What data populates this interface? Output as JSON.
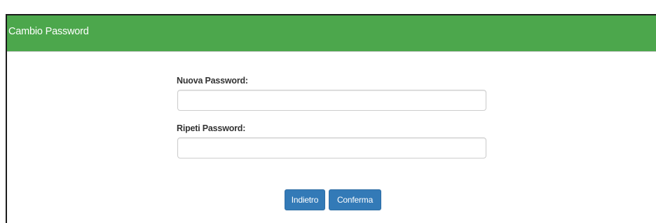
{
  "header": {
    "title": "Cambio Password"
  },
  "form": {
    "new_password": {
      "label": "Nuova Password:",
      "value": "",
      "placeholder": ""
    },
    "repeat_password": {
      "label": "Ripeti Password:",
      "value": "",
      "placeholder": ""
    }
  },
  "actions": {
    "back_label": "Indietro",
    "confirm_label": "Conferma"
  },
  "colors": {
    "header_background": "#4ca74c",
    "button_primary": "#337ab7"
  }
}
